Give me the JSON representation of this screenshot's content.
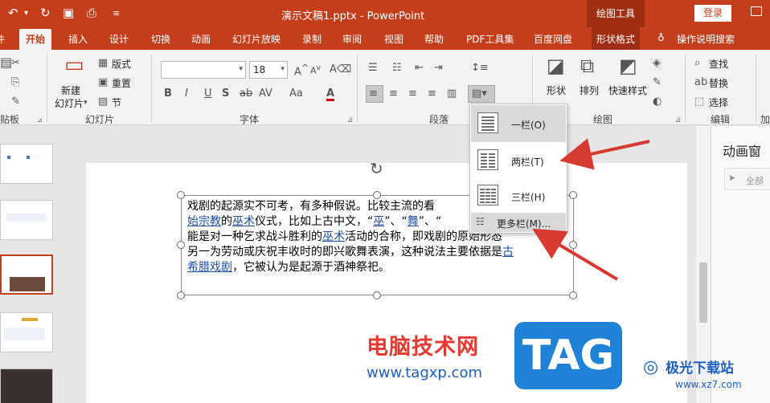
{
  "window": {
    "title": "演示文稿1.pptx - PowerPoint",
    "contextual_tab": "绘图工具",
    "login_label": "登录"
  },
  "tabs": {
    "partial_left": "件",
    "home": "开始",
    "insert": "插入",
    "design": "设计",
    "transitions": "切换",
    "animations": "动画",
    "slideshow": "幻灯片放映",
    "record": "录制",
    "review": "审阅",
    "view": "视图",
    "help": "帮助",
    "pdf": "PDF工具集",
    "baidu": "百度网盘",
    "shape_format": "形状格式",
    "tell_me": "操作说明搜索"
  },
  "ribbon": {
    "clipboard_label": "贴板",
    "slides": {
      "new_slide_line1": "新建",
      "new_slide_line2": "幻灯片",
      "layout": "版式",
      "reset": "重置",
      "section": "节",
      "label": "幻灯片"
    },
    "font": {
      "size_value": "18",
      "label": "字体"
    },
    "paragraph": {
      "label": "段落"
    },
    "drawing": {
      "shapes": "形状",
      "arrange": "排列",
      "quick_styles": "快速样式",
      "label": "绘图"
    },
    "editing": {
      "find": "查找",
      "replace": "替换",
      "select": "选择",
      "label": "编辑"
    },
    "partial_right": "加"
  },
  "columns_menu": {
    "one": "一栏(O)",
    "two": "两栏(T)",
    "three": "三栏(H)",
    "more": "更多栏(M)..."
  },
  "slide_text": {
    "p1": "戏剧的起源实不可考，有多种假说。比较主流的看",
    "p2a": "始宗教",
    "p2b": "的",
    "p2c": "巫术",
    "p2d": "仪式，比如上古中文，“",
    "p2e": "巫",
    "p2f": "”、“",
    "p2g": "舞",
    "p2h": "”、“",
    "p3a": "能是对一种乞求战斗胜利的",
    "p3b": "巫术",
    "p3c": "活动的合称，即戏剧的原始形态",
    "p4a": "另一为劳动或庆祝丰收时的即兴歌舞表演，这种说法主要依据是",
    "p4b": "古",
    "p5a": "希腊戏剧",
    "p5b": "，它被认为是起源于酒神祭祀。"
  },
  "anim_pane": {
    "title": "动画窗",
    "play_all": "全部"
  },
  "watermark": {
    "cn": "电脑技术网",
    "url": "www.tagxp.com",
    "tag": "TAG",
    "site": "极光下载站",
    "site_url": "www.xz7.com"
  },
  "colors": {
    "accent": "#c43e1c",
    "arrow": "#d63a30"
  }
}
